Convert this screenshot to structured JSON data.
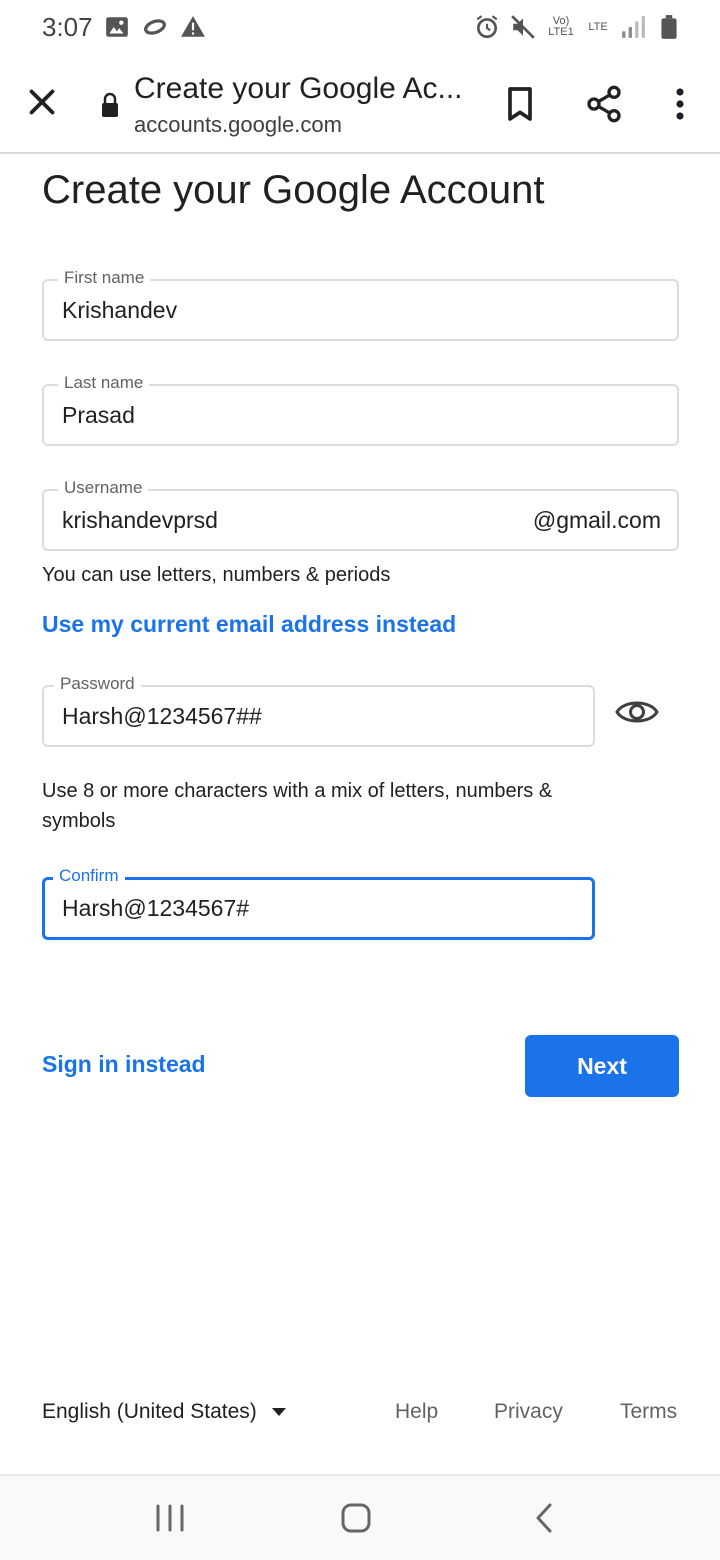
{
  "status_bar": {
    "time": "3:07",
    "network": "LTE",
    "network_sub": "Vo) LTE1"
  },
  "browser": {
    "page_title": "Create your Google Ac...",
    "url": "accounts.google.com"
  },
  "form": {
    "heading": "Create your Google Account",
    "first_name": {
      "label": "First name",
      "value": "Krishandev"
    },
    "last_name": {
      "label": "Last name",
      "value": "Prasad"
    },
    "username": {
      "label": "Username",
      "value": "krishandevprsd",
      "suffix": "@gmail.com"
    },
    "username_hint": "You can use letters, numbers & periods",
    "use_email_link": "Use my current email address instead",
    "password": {
      "label": "Password",
      "value": "Harsh@1234567##"
    },
    "password_hint": "Use 8 or more characters with a mix of letters, numbers & symbols",
    "confirm": {
      "label": "Confirm",
      "value": "Harsh@1234567#"
    },
    "sign_in_link": "Sign in instead",
    "next_button": "Next"
  },
  "footer": {
    "language": "English (United States)",
    "help": "Help",
    "privacy": "Privacy",
    "terms": "Terms"
  },
  "colors": {
    "accent": "#1a73e8",
    "border": "#dadce0"
  }
}
